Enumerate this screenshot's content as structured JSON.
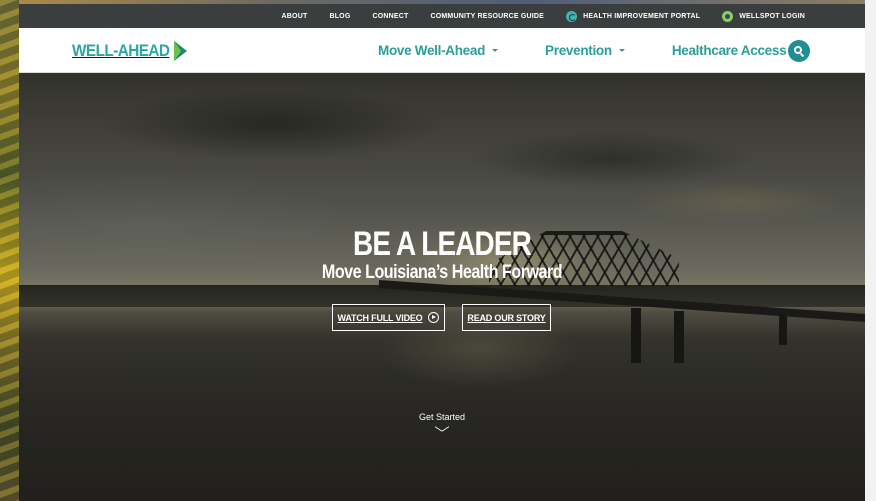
{
  "utility_nav": {
    "links": [
      {
        "label": "ABOUT"
      },
      {
        "label": "BLOG"
      },
      {
        "label": "CONNECT"
      },
      {
        "label": "COMMUNITY RESOURCE GUIDE"
      },
      {
        "label": "HEALTH IMPROVEMENT PORTAL",
        "icon": "compass-icon"
      },
      {
        "label": "WELLSPOT LOGIN",
        "icon": "wellspot-icon"
      }
    ]
  },
  "header": {
    "logo_text": "WELL-AHEAD",
    "nav": [
      {
        "label": "Move Well-Ahead"
      },
      {
        "label": "Prevention"
      },
      {
        "label": "Healthcare Access"
      }
    ],
    "search_icon": "search-icon"
  },
  "hero": {
    "title": "BE A LEADER",
    "subtitle": "Move Louisiana’s Health Forward",
    "watch_label": "WATCH FULL VIDEO",
    "story_label": "READ OUR STORY",
    "get_started": "Get Started"
  },
  "colors": {
    "brand_teal": "#2b9e9a",
    "utility_bar": "#3b3e3f",
    "search_button": "#1e8f95"
  }
}
